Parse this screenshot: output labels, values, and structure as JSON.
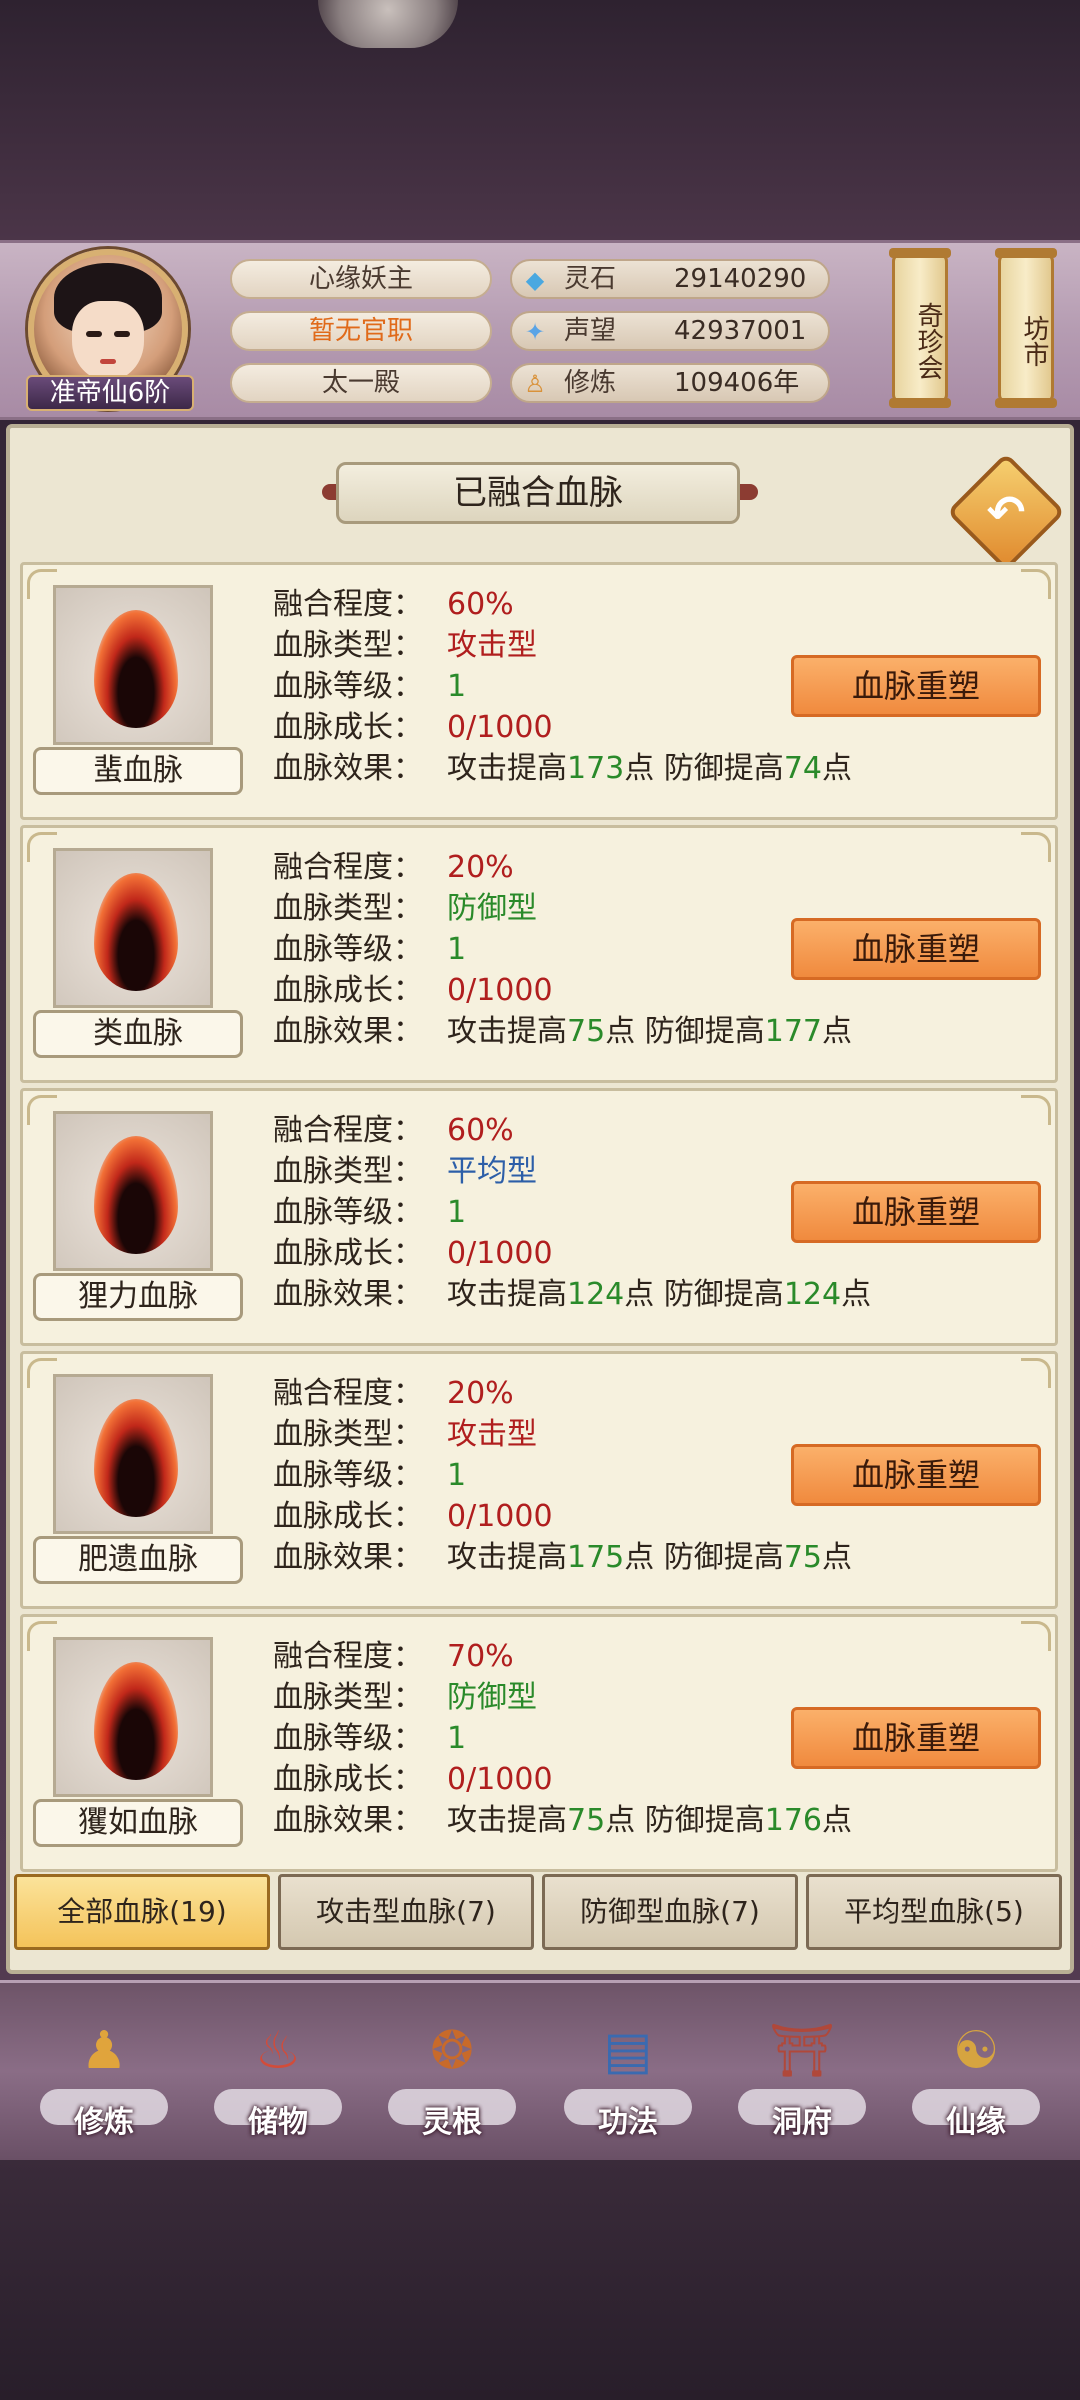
{
  "header": {
    "rank": "准帝仙6阶",
    "pills": [
      "心缘妖主",
      "暂无官职",
      "太一殿"
    ],
    "resources": [
      {
        "icon": "spirit-stone-icon",
        "glyph": "◆",
        "color": "#4aa8e0",
        "label": "灵石",
        "value": "29140290"
      },
      {
        "icon": "prestige-icon",
        "glyph": "✦",
        "color": "#5aa4e6",
        "label": "声望",
        "value": "42937001"
      },
      {
        "icon": "cultivation-icon",
        "glyph": "♙",
        "color": "#d9923a",
        "label": "修炼",
        "value": "109406年"
      }
    ],
    "scroll_buttons": [
      "奇珍会",
      "坊市"
    ]
  },
  "panel": {
    "title": "已融合血脉"
  },
  "stat_labels": {
    "fusion": "融合程度：",
    "type": "血脉类型：",
    "level": "血脉等级：",
    "growth": "血脉成长：",
    "effect": "血脉效果："
  },
  "cards": [
    {
      "name": "蜚血脉",
      "fusion": "60%",
      "type": "攻击型",
      "type_color": "red",
      "level": "1",
      "growth": "0/1000",
      "atk_prefix": "攻击提高",
      "atk": "173",
      "atk_suffix": "点",
      "def_prefix": "防御提高",
      "def": "74",
      "def_suffix": "点",
      "button": "血脉重塑"
    },
    {
      "name": "类血脉",
      "fusion": "20%",
      "type": "防御型",
      "type_color": "green",
      "level": "1",
      "growth": "0/1000",
      "atk_prefix": "攻击提高",
      "atk": "75",
      "atk_suffix": "点",
      "def_prefix": "防御提高",
      "def": "177",
      "def_suffix": "点",
      "button": "血脉重塑"
    },
    {
      "name": "狸力血脉",
      "fusion": "60%",
      "type": "平均型",
      "type_color": "blue",
      "level": "1",
      "growth": "0/1000",
      "atk_prefix": "攻击提高",
      "atk": "124",
      "atk_suffix": "点",
      "def_prefix": "防御提高",
      "def": "124",
      "def_suffix": "点",
      "button": "血脉重塑"
    },
    {
      "name": "肥遗血脉",
      "fusion": "20%",
      "type": "攻击型",
      "type_color": "red",
      "level": "1",
      "growth": "0/1000",
      "atk_prefix": "攻击提高",
      "atk": "175",
      "atk_suffix": "点",
      "def_prefix": "防御提高",
      "def": "75",
      "def_suffix": "点",
      "button": "血脉重塑"
    },
    {
      "name": "玃如血脉",
      "fusion": "70%",
      "type": "防御型",
      "type_color": "green",
      "level": "1",
      "growth": "0/1000",
      "atk_prefix": "攻击提高",
      "atk": "75",
      "atk_suffix": "点",
      "def_prefix": "防御提高",
      "def": "176",
      "def_suffix": "点",
      "button": "血脉重塑"
    }
  ],
  "tabs": [
    {
      "label": "全部血脉(19)",
      "active": true
    },
    {
      "label": "攻击型血脉(7)",
      "active": false
    },
    {
      "label": "防御型血脉(7)",
      "active": false
    },
    {
      "label": "平均型血脉(5)",
      "active": false
    }
  ],
  "nav": [
    {
      "label": "修炼",
      "icon": "cultivate-icon",
      "glyph": "♟",
      "color": "#e0a43c"
    },
    {
      "label": "储物",
      "icon": "storage-bag-icon",
      "glyph": "♨",
      "color": "#d24c3a"
    },
    {
      "label": "灵根",
      "icon": "spirit-root-icon",
      "glyph": "❂",
      "color": "#c86a2a"
    },
    {
      "label": "功法",
      "icon": "technique-book-icon",
      "glyph": "▤",
      "color": "#3a6ab0"
    },
    {
      "label": "洞府",
      "icon": "cave-mansion-icon",
      "glyph": "⛩",
      "color": "#b0483a"
    },
    {
      "label": "仙缘",
      "icon": "immortal-fate-icon",
      "glyph": "☯",
      "color": "#d6a440"
    }
  ]
}
